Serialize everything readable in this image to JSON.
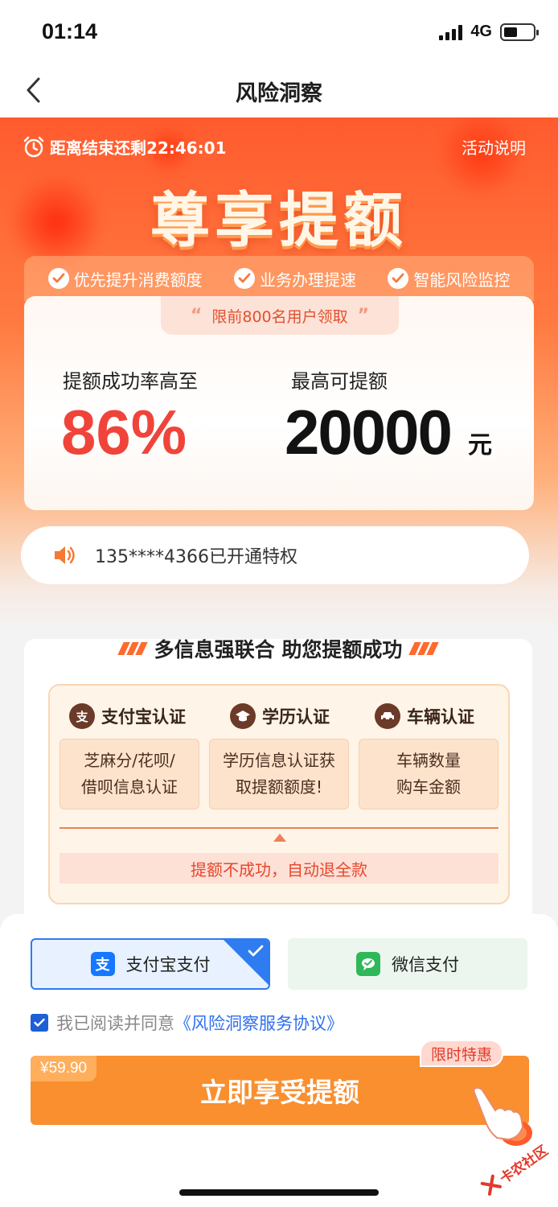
{
  "status_bar": {
    "time": "01:14",
    "network": "4G"
  },
  "nav": {
    "title": "风险洞察"
  },
  "hero": {
    "countdown": "距离结束还剩22:46:01",
    "activity_link": "活动说明",
    "title": "尊享提额",
    "features": [
      "优先提升消费额度",
      "业务办理提速",
      "智能风险监控"
    ]
  },
  "quota": {
    "limit_badge": "限前800名用户领取",
    "rate_label": "提额成功率高至",
    "rate_value": "86%",
    "amount_label": "最高可提额",
    "amount_value": "20000",
    "amount_unit": "元"
  },
  "notice": {
    "text": "135****4366已开通特权"
  },
  "info": {
    "title": "多信息强联合 助您提额成功",
    "auth": [
      {
        "label": "支付宝认证",
        "icon": "alipay-icon",
        "desc": [
          "芝麻分/花呗/",
          "借呗信息认证"
        ]
      },
      {
        "label": "学历认证",
        "icon": "graduation-cap-icon",
        "desc": [
          "学历信息认证获",
          "取提额额度!"
        ]
      },
      {
        "label": "车辆认证",
        "icon": "car-icon",
        "desc": [
          "车辆数量",
          "购车金额"
        ]
      }
    ],
    "refund": "提额不成功，自动退全款"
  },
  "payment": {
    "alipay_label": "支付宝支付",
    "wechat_label": "微信支付",
    "selected": "alipay"
  },
  "agreement": {
    "prefix": "我已阅读并同意",
    "link": "《风险洞察服务协议》",
    "checked": true
  },
  "cta": {
    "price": "¥59.90",
    "label": "立即享受提额",
    "promo": "限时特惠"
  },
  "watermark": {
    "text": "卡农社区"
  },
  "colors": {
    "primary_orange": "#f98f2f",
    "hero_red": "#ff5b2e",
    "rate_red": "#f0443a",
    "link_blue": "#2f6ff0"
  }
}
